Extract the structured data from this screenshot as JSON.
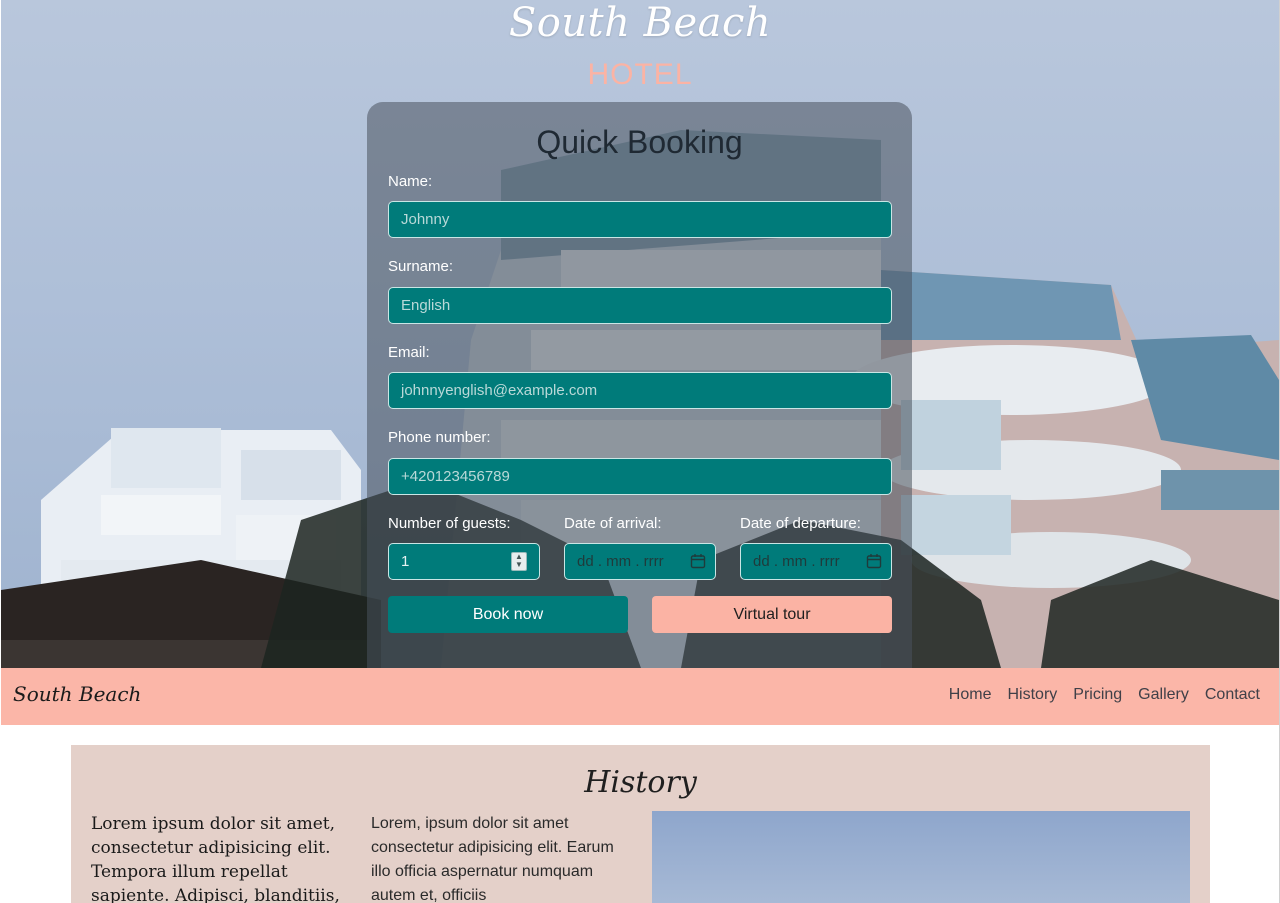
{
  "hero": {
    "brand": "South Beach",
    "subtitle": "HOTEL"
  },
  "booking": {
    "title": "Quick Booking",
    "name_label": "Name:",
    "name_placeholder": "Johnny",
    "surname_label": "Surname:",
    "surname_placeholder": "English",
    "email_label": "Email:",
    "email_placeholder": "johnnyenglish@example.com",
    "phone_label": "Phone number:",
    "phone_placeholder": "+420123456789",
    "guests_label": "Number of guests:",
    "guests_value": "1",
    "arrival_label": "Date of arrival:",
    "arrival_placeholder": "dd . mm . rrrr",
    "departure_label": "Date of departure:",
    "departure_placeholder": "dd . mm . rrrr",
    "book_label": "Book now",
    "tour_label": "Virtual tour"
  },
  "navbar": {
    "brand": "South Beach",
    "links": [
      "Home",
      "History",
      "Pricing",
      "Gallery",
      "Contact"
    ]
  },
  "history": {
    "title": "History",
    "col1_text": "Lorem ipsum dolor sit amet, consectetur adipisicing elit. Tempora illum repellat sapiente. Adipisci, blanditiis,",
    "col2_text": "Lorem, ipsum dolor sit amet consectetur adipisicing elit. Earum illo officia aspernatur numquam autem et, officiis"
  },
  "colors": {
    "teal": "#007b7a",
    "salmon": "#fbb3a4",
    "history_bg": "#e4d0c9"
  },
  "icons": {
    "calendar": "calendar-icon",
    "spinner": "number-stepper-icon"
  }
}
